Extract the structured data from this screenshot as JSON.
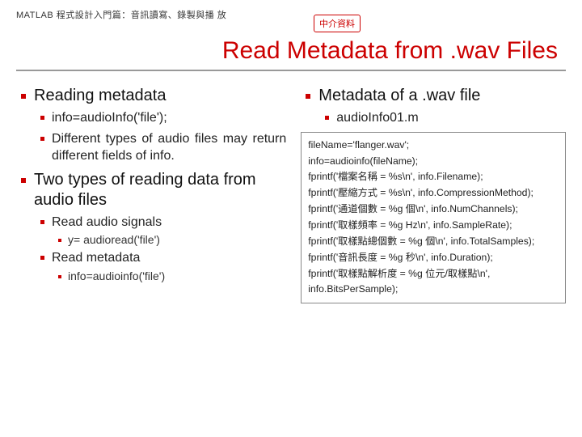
{
  "header": "MATLAB 程式設計入門篇：音訊讀寫、錄製與播 放",
  "badge": "中介資料",
  "title": "Read Metadata from .wav Files",
  "left": {
    "b1": {
      "head": "Reading metadata",
      "s1": "info=audioInfo('file');",
      "s2": "Different types of audio files may return different fields of info."
    },
    "b2": {
      "head": "Two types of reading data from audio files",
      "s1": "Read audio signals",
      "s1a": "y= audioread('file')",
      "s2": "Read metadata",
      "s2a": "info=audioinfo('file')"
    }
  },
  "right": {
    "head": "Metadata of a .wav file",
    "s1": "audioInfo01.m",
    "code": {
      "l1": "fileName='flanger.wav';",
      "l2": "info=audioinfo(fileName);",
      "l3": "fprintf('檔案名稱 = %s\\n', info.Filename);",
      "l4": "fprintf('壓縮方式 = %s\\n', info.CompressionMethod);",
      "l5": "fprintf('通道個數 = %g 個\\n', info.NumChannels);",
      "l6": "fprintf('取樣頻率 = %g Hz\\n', info.SampleRate);",
      "l7": "fprintf('取樣點總個數 = %g 個\\n', info.TotalSamples);",
      "l8": "fprintf('音訊長度 = %g 秒\\n', info.Duration);",
      "l9": "fprintf('取樣點解析度 = %g 位元/取樣點\\n', info.BitsPerSample);"
    }
  }
}
